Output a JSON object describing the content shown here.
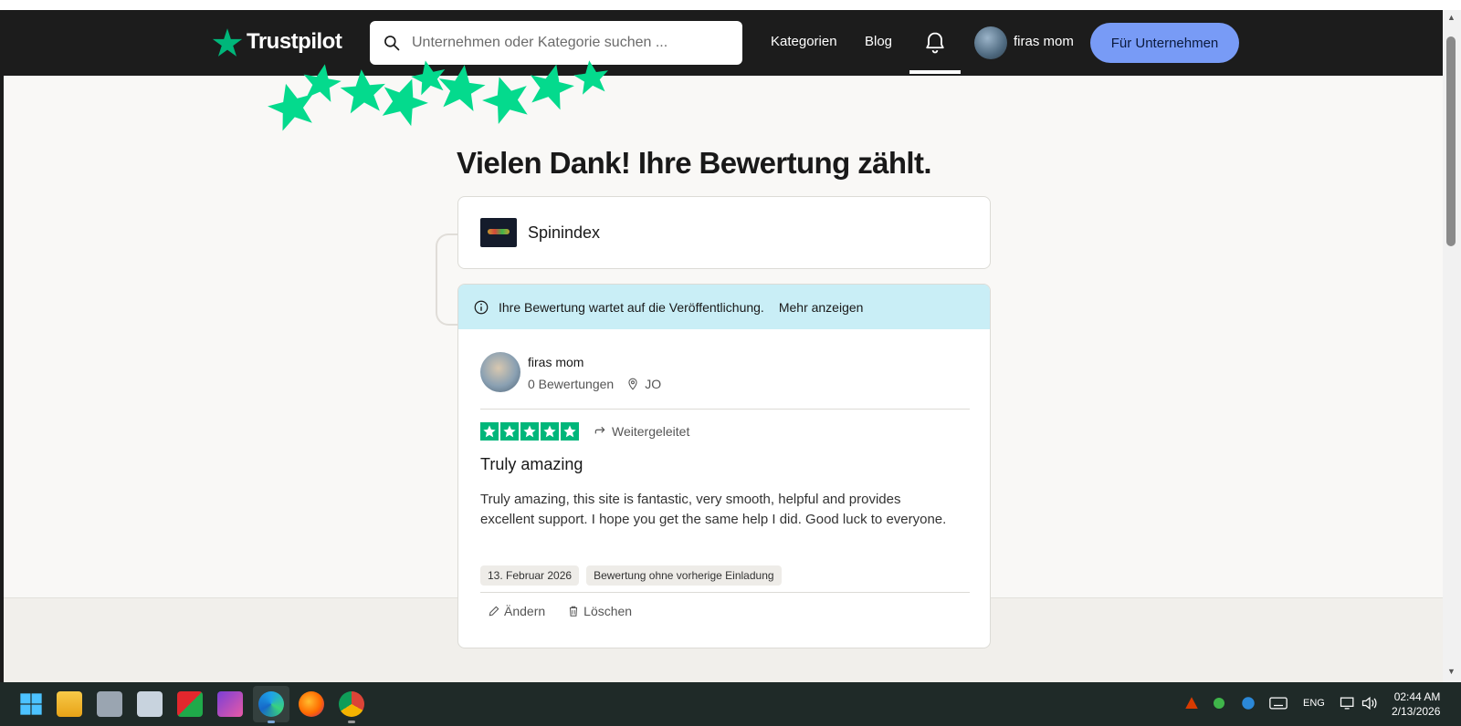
{
  "nav": {
    "brand": "Trustpilot",
    "search_placeholder": "Unternehmen oder Kategorie suchen ...",
    "categories": "Kategorien",
    "blog": "Blog",
    "username": "firas mom",
    "business_button": "Für Unternehmen"
  },
  "page": {
    "heading": "Vielen Dank! Ihre Bewertung zählt.",
    "company_name": "Spinindex",
    "notice": "Ihre Bewertung wartet auf die Veröffentlichung.",
    "notice_link": "Mehr anzeigen"
  },
  "review": {
    "author": "firas mom",
    "review_count": "0 Bewertungen",
    "country": "JO",
    "rating": 5,
    "forwarded": "Weitergeleitet",
    "title": "Truly amazing",
    "body": "Truly amazing, this site is fantastic, very smooth, helpful and provides excellent support. I hope you get the same help I did. Good luck to everyone.",
    "date_tag": "13. Februar 2026",
    "invite_tag": "Bewertung ohne vorherige Einladung",
    "edit": "Ändern",
    "delete": "Löschen"
  },
  "taskbar": {
    "language": "ENG",
    "time": "02:44 AM",
    "date": "2/13/2026"
  },
  "colors": {
    "brand_green": "#00b67a",
    "nav_bg": "#1c1c1c",
    "business_button": "#789bf6",
    "notice_bg": "#c9eef6"
  }
}
